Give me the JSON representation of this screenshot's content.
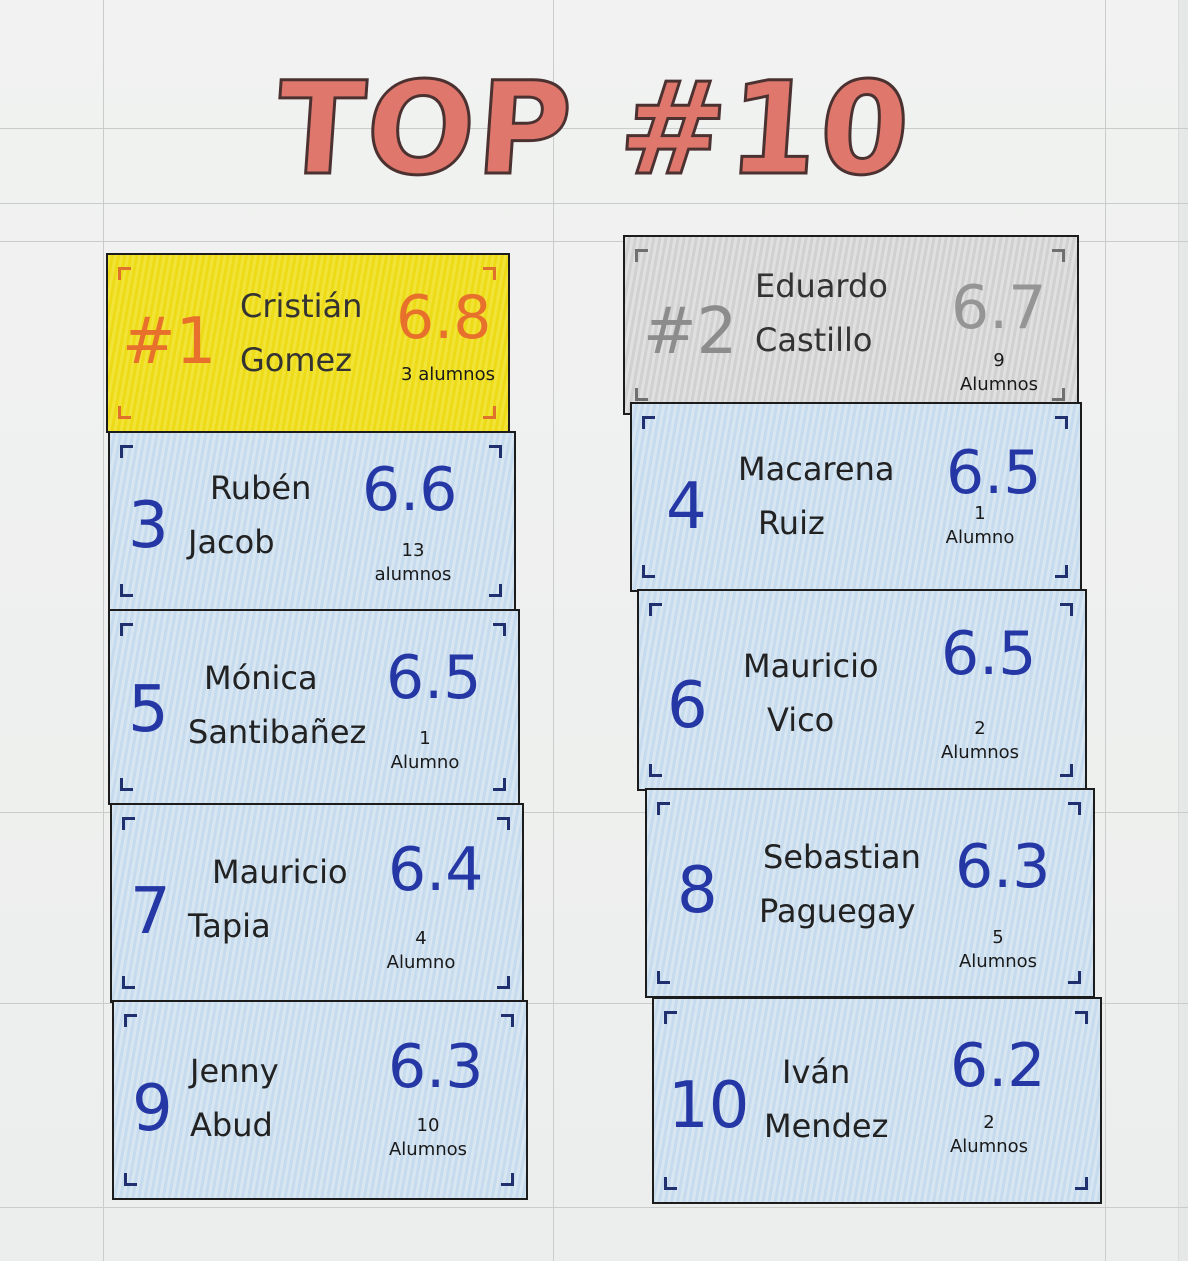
{
  "title": "TOP #10",
  "colors": {
    "gold": "#f0df1c",
    "silver": "#d6d7d6",
    "blue": "#cfe0ef",
    "ink_blue": "#2537a5",
    "title_red": "#e0776d"
  },
  "ranking": [
    {
      "rank": "#1",
      "first_name": "Cristián",
      "last_name": "Gomez",
      "score": "6.8",
      "count_number": "",
      "count_label": "3 alumnos"
    },
    {
      "rank": "#2",
      "first_name": "Eduardo",
      "last_name": "Castillo",
      "score": "6.7",
      "count_number": "9",
      "count_label": "Alumnos"
    },
    {
      "rank": "3",
      "first_name": "Rubén",
      "last_name": "Jacob",
      "score": "6.6",
      "count_number": "13",
      "count_label": "alumnos"
    },
    {
      "rank": "4",
      "first_name": "Macarena",
      "last_name": "Ruiz",
      "score": "6.5",
      "count_number": "1",
      "count_label": "Alumno"
    },
    {
      "rank": "5",
      "first_name": "Mónica",
      "last_name": "Santibañez",
      "score": "6.5",
      "count_number": "1",
      "count_label": "Alumno"
    },
    {
      "rank": "6",
      "first_name": "Mauricio",
      "last_name": "Vico",
      "score": "6.5",
      "count_number": "2",
      "count_label": "Alumnos"
    },
    {
      "rank": "7",
      "first_name": "Mauricio",
      "last_name": "Tapia",
      "score": "6.4",
      "count_number": "4",
      "count_label": "Alumno"
    },
    {
      "rank": "8",
      "first_name": "Sebastian",
      "last_name": "Paguegay",
      "score": "6.3",
      "count_number": "5",
      "count_label": "Alumnos"
    },
    {
      "rank": "9",
      "first_name": "Jenny",
      "last_name": "Abud",
      "score": "6.3",
      "count_number": "10",
      "count_label": "Alumnos"
    },
    {
      "rank": "10",
      "first_name": "Iván",
      "last_name": "Mendez",
      "score": "6.2",
      "count_number": "2",
      "count_label": "Alumnos"
    }
  ]
}
